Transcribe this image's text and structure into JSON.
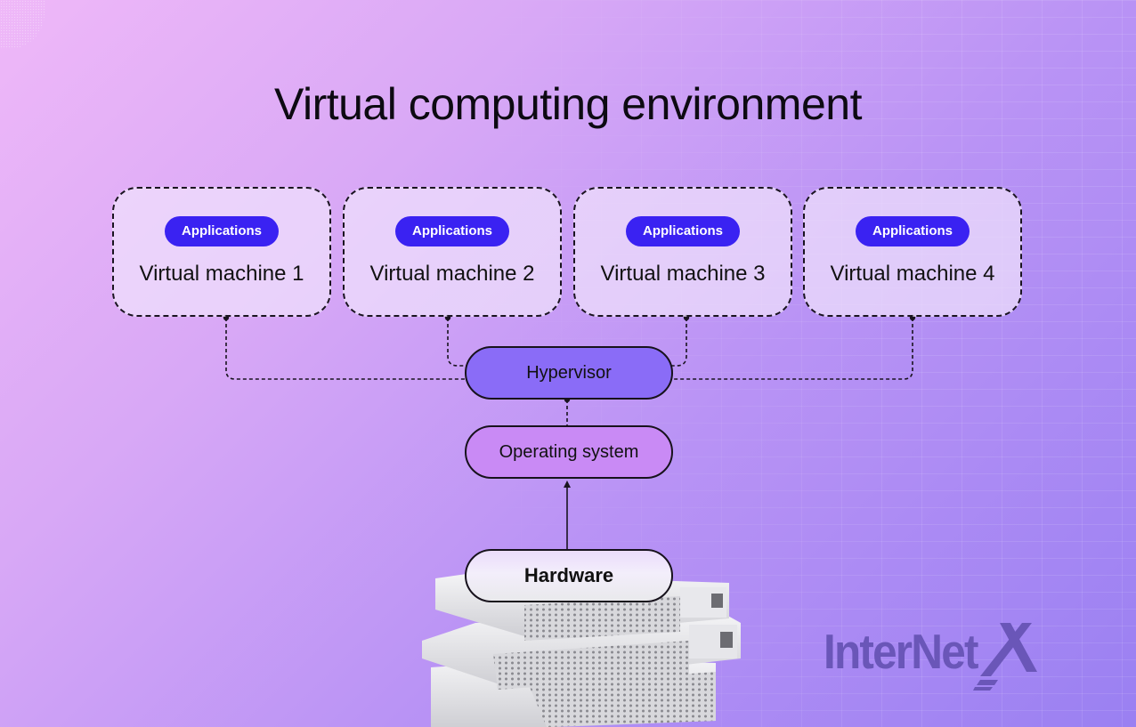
{
  "title": "Virtual computing environment",
  "virtual_machines": [
    {
      "app_label": "Applications",
      "label": "Virtual machine 1"
    },
    {
      "app_label": "Applications",
      "label": "Virtual machine 2"
    },
    {
      "app_label": "Applications",
      "label": "Virtual machine 3"
    },
    {
      "app_label": "Applications",
      "label": "Virtual machine 4"
    }
  ],
  "layers": {
    "hypervisor": "Hypervisor",
    "operating_system": "Operating system",
    "hardware": "Hardware"
  },
  "logo": {
    "text": "InterNet",
    "mark": "X"
  },
  "colors": {
    "applications_pill": "#3a22f2",
    "hypervisor": "#8a6cf7",
    "operating_system": "#c98af5",
    "logo": "#6a56b8"
  }
}
